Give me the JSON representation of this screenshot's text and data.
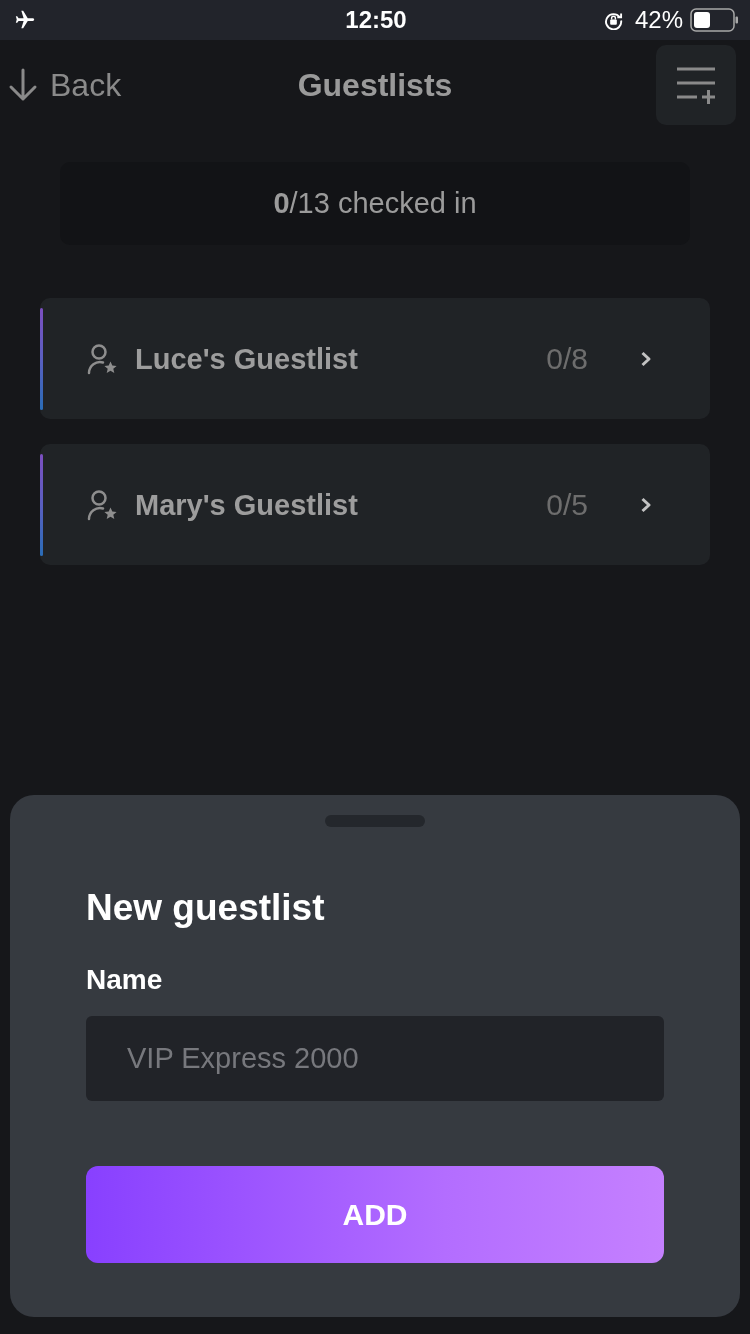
{
  "status_bar": {
    "time": "12:50",
    "battery": "42%"
  },
  "nav": {
    "back": "Back",
    "title": "Guestlists"
  },
  "summary": "**0**/13 checked in",
  "guestlists": [
    {
      "name": "Luce's Guestlist",
      "count": "0/8"
    },
    {
      "name": "Mary's Guestlist",
      "count": "0/5"
    }
  ],
  "sheet": {
    "title": "New guestlist",
    "field_label": "Name",
    "placeholder": "VIP Express 2000",
    "button": "ADD"
  }
}
